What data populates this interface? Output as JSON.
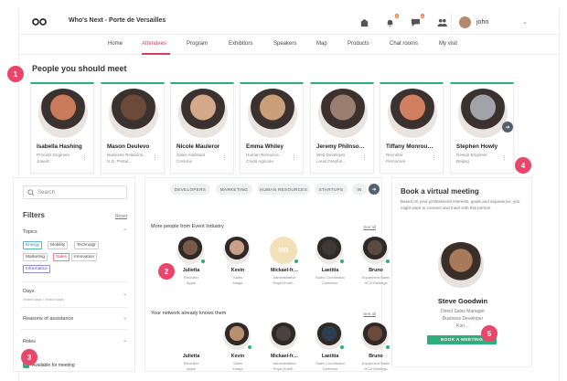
{
  "header": {
    "title": "Who's Next - Porte de Versailles",
    "notif_badge_1": "2",
    "notif_badge_2": "4",
    "user_name": "john"
  },
  "nav": {
    "items": [
      "Home",
      "Attendees",
      "Program",
      "Exhibitors",
      "Speakers",
      "Map",
      "Products",
      "Chat rooms",
      "My visit"
    ],
    "active_index": 1
  },
  "callouts": [
    "1",
    "2",
    "3",
    "4",
    "5"
  ],
  "people_section": {
    "title": "People you should meet",
    "people": [
      {
        "name": "Isabella Hashing",
        "job": "Process Engineer",
        "company": "Jowalz",
        "color": "#c97a5b"
      },
      {
        "name": "Mason Deulevo",
        "job": "Business Relations…",
        "company": "U.D. Postal…",
        "color": "#6b4a3a"
      },
      {
        "name": "Nicole Mauleror",
        "job": "Sales Assistant",
        "company": "Cenlone",
        "color": "#d4a98a"
      },
      {
        "name": "Emma Whiley",
        "job": "Human Resource…",
        "company": "Credit Agricole",
        "color": "#c99f7a"
      },
      {
        "name": "Jeremy Philnso…",
        "job": "Web Developer",
        "company": "Louis Dreyfus…",
        "color": "#9a7f70"
      },
      {
        "name": "Tiffany Monrou…",
        "job": "Recruiter",
        "company": "Pernoroes",
        "color": "#d08060"
      },
      {
        "name": "Stephen Howly",
        "job": "Design Engineer",
        "company": "Beijing",
        "color": "#a0a4a8"
      }
    ]
  },
  "filters": {
    "search_placeholder": "Search",
    "title": "Filters",
    "reset": "Reset",
    "topics_label": "Topics",
    "tags": [
      "Energy",
      "Mobility",
      "Technolgr",
      "Marketing",
      "Sales",
      "Innovation",
      "Informatica"
    ],
    "days_label": "Days",
    "days_sub": "Select days / Select days",
    "reasons_label": "Reasons of assistance",
    "roles_label": "Roles",
    "available_label": "Available for meeting"
  },
  "categories": [
    "DEVELOPERS",
    "MARKETING",
    "HUMAN RESOURCES",
    "STARTUPS",
    "IN"
  ],
  "industry_section": {
    "title": "More people from Event Industry",
    "see_all": "See all",
    "people": [
      {
        "name": "Julietta",
        "job": "Recruiter",
        "company": "Apple",
        "color": "#7a5a48",
        "online": true
      },
      {
        "name": "Kevin",
        "job": "Sales",
        "company": "Image",
        "color": "#c8a08a",
        "online": false
      },
      {
        "name": "Mickael-fr…",
        "job": "Administrative",
        "company": "Royal Khalil…",
        "color": "#f2e0b8",
        "initials": "MB",
        "online": true
      },
      {
        "name": "Laetitia",
        "job": "Sales Coordinator",
        "company": "Carrefour",
        "color": "#3e3a38",
        "online": true
      },
      {
        "name": "Bruno",
        "job": "Equipment Sales",
        "company": "HCA Holdings",
        "color": "#5a4a40",
        "online": true
      }
    ]
  },
  "network_section": {
    "title": "Your network already knows them",
    "see_all": "See all",
    "people": [
      {
        "name": "Julietta",
        "job": "Recruiter",
        "company": "Apple",
        "color": "#ffffff",
        "online": false
      },
      {
        "name": "Kevin",
        "job": "Sales",
        "company": "Image",
        "color": "#b89070",
        "online": true
      },
      {
        "name": "Mickael-fr…",
        "job": "Administrative",
        "company": "Royal Khalil…",
        "color": "#4a4240",
        "online": false
      },
      {
        "name": "Laetitia",
        "job": "Sales Coordinator",
        "company": "Carrefour",
        "color": "#2e3e50",
        "online": true
      },
      {
        "name": "Bruno",
        "job": "Equipment Sales",
        "company": "HCA Holdings",
        "color": "#6a4a3a",
        "online": true
      }
    ]
  },
  "virtual_meeting": {
    "title": "Book a virtual meeting",
    "description": "Based on your professional interests, goals and experience, you might want to connect and meet with this person.",
    "name": "Steve Goodwin",
    "job": "Direct Sales Manager",
    "job2": "Business Developer",
    "company": "Kon…",
    "button": "BOOK A MEETING",
    "color": "#a87a5a"
  },
  "colors": {
    "accent": "#d43f5b",
    "green": "#2fae7d",
    "callout": "#e8476a"
  }
}
